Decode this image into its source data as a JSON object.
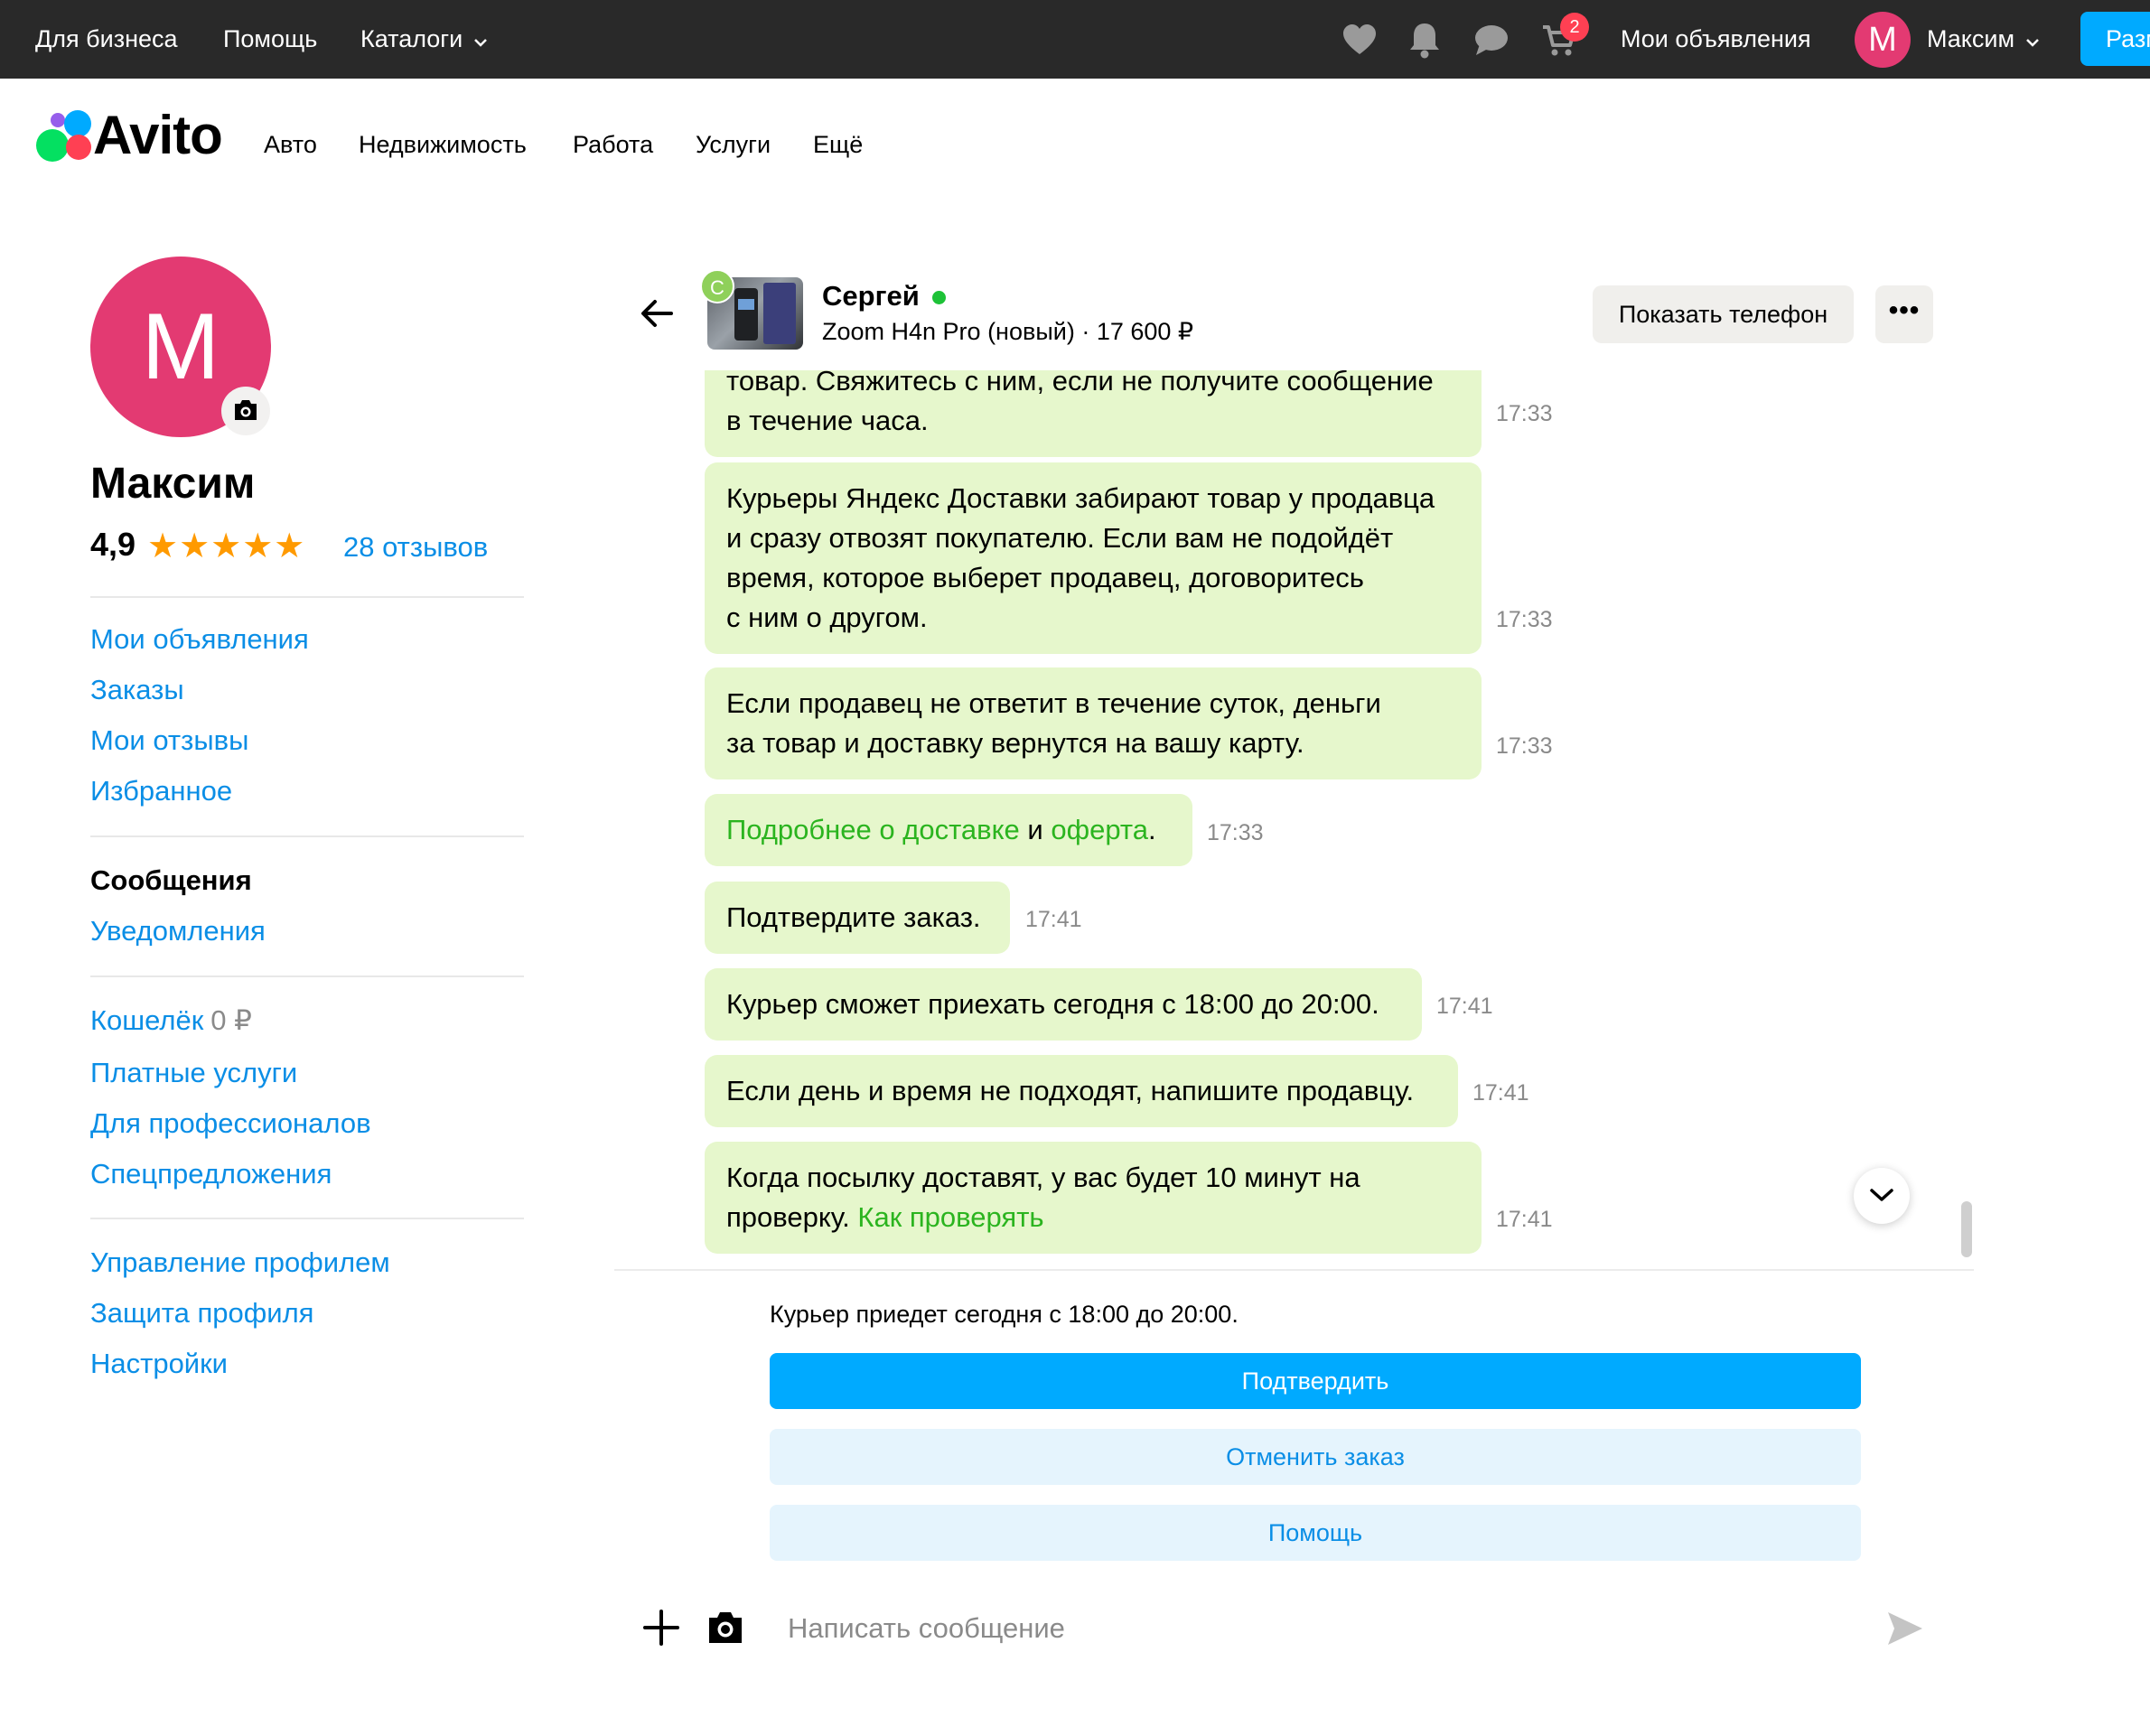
{
  "topbar": {
    "business": "Для бизнеса",
    "help": "Помощь",
    "catalogs": "Каталоги",
    "icons": [
      "heart-icon",
      "bell-icon",
      "chat-icon",
      "cart-icon"
    ],
    "cart_count": "2",
    "my_ads": "Мои объявления",
    "avatar_letter": "М",
    "user_name": "Максим",
    "post_button": "Разм"
  },
  "logo": {
    "text": "Avito"
  },
  "categories": [
    "Авто",
    "Недвижимость",
    "Работа",
    "Услуги",
    "Ещё"
  ],
  "profile": {
    "avatar_letter": "М",
    "name": "Максим",
    "rating": "4,9",
    "stars": "★★★★★",
    "reviews": "28 отзывов"
  },
  "sidebar": {
    "group1": [
      "Мои объявления",
      "Заказы",
      "Мои отзывы",
      "Избранное"
    ],
    "messages_active": "Сообщения",
    "notifications": "Уведомления",
    "wallet": {
      "label": "Кошелёк",
      "amount": "0 ₽"
    },
    "group3": [
      "Платные услуги",
      "Для профессионалов",
      "Спецпредложения"
    ],
    "group4": [
      "Управление профилем",
      "Защита профиля",
      "Настройки"
    ]
  },
  "chat": {
    "seller_letter": "С",
    "seller_name": "Сергей",
    "seller_online": true,
    "item_title": "Zoom H4n Pro (новый)",
    "item_price": "17 600 ₽",
    "show_phone": "Показать телефон",
    "more": "•••",
    "messages": [
      {
        "lines": [
          "товар. Свяжитесь с ним, если не получите сообщение",
          "в течение часа."
        ],
        "time": "17:33"
      },
      {
        "lines": [
          "Курьеры Яндекс Доставки забирают товар у продавца",
          "и сразу отвозят покупателю. Если вам не подойдёт",
          "время, которое выберет продавец, договоритесь",
          "с ним о другом."
        ],
        "time": "17:33"
      },
      {
        "lines": [
          "Если продавец не ответит в течение суток, деньги",
          "за товар и доставку вернутся на вашу карту."
        ],
        "time": "17:33"
      },
      {
        "link1": "Подробнее о доставке",
        "mid": " и ",
        "link2": "оферта",
        "end": ".",
        "time": "17:33"
      },
      {
        "text": "Подтвердите заказ.",
        "time": "17:41"
      },
      {
        "text": "Курьер сможет приехать сегодня с 18:00 до 20:00.",
        "time": "17:41"
      },
      {
        "text": "Если день и время не подходят, напишите продавцу.",
        "time": "17:41"
      },
      {
        "line1": "Когда посылку доставят, у вас будет 10 минут на",
        "line2_text": "проверку. ",
        "line2_link": "Как проверять",
        "time": "17:41"
      }
    ]
  },
  "action_panel": {
    "courier_text": "Курьер приедет сегодня с 18:00 до 20:00.",
    "confirm": "Подтвердить",
    "cancel": "Отменить заказ",
    "help": "Помощь"
  },
  "composer": {
    "placeholder": "Написать сообщение",
    "value": ""
  },
  "colors": {
    "topbar_bg": "#292929",
    "accent_blue": "#00aaff",
    "link_blue": "#0a8ee6",
    "bubble_green": "#e6f7cc",
    "link_green": "#2bb41f",
    "avatar_pink": "#e33a72",
    "star_orange": "#ff9a00"
  }
}
